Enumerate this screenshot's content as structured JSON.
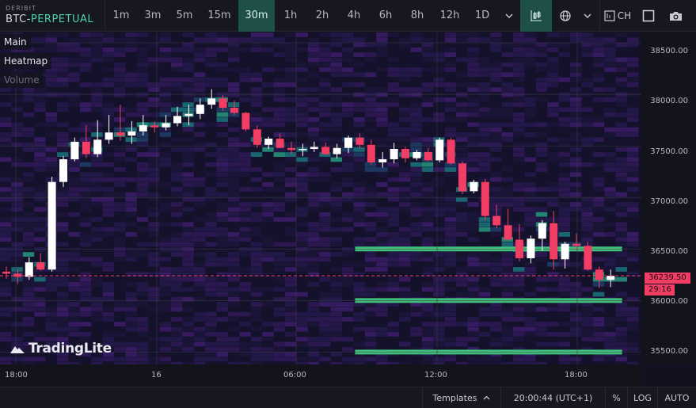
{
  "symbol": {
    "exchange": "DERIBIT",
    "pair": "BTC-",
    "pair_suffix": "PERPETUAL"
  },
  "timeframes": [
    {
      "label": "1m"
    },
    {
      "label": "3m"
    },
    {
      "label": "5m"
    },
    {
      "label": "15m"
    },
    {
      "label": "30m",
      "active": true
    },
    {
      "label": "1h"
    },
    {
      "label": "2h"
    },
    {
      "label": "4h"
    },
    {
      "label": "6h"
    },
    {
      "label": "8h"
    },
    {
      "label": "12h"
    },
    {
      "label": "1D"
    }
  ],
  "toolbar": {
    "more_timeframes_icon": "chevron-down-icon",
    "chart_type_icon": "candlestick-icon",
    "indicators_icon": "globe-icon",
    "compare_label": "CH",
    "compare_icon": "compare-icon",
    "fullscreen_icon": "fullscreen-icon",
    "screenshot_icon": "camera-icon"
  },
  "layers": {
    "main": "Main",
    "heatmap": "Heatmap",
    "volume": "Volume"
  },
  "price_axis": {
    "labels": [
      "38500.00",
      "38000.00",
      "37500.00",
      "37000.00",
      "36500.00",
      "36000.00",
      "35500.00"
    ],
    "current_price": "36239.50",
    "countdown": "29:16"
  },
  "time_axis": {
    "labels": [
      "18:00",
      "16",
      "06:00",
      "12:00",
      "18:00"
    ]
  },
  "logo": "TradingLite",
  "statusbar": {
    "templates_label": "Templates",
    "templates_icon": "chevron-up-icon",
    "clock": "20:00:44 (UTC+1)",
    "percent_label": "%",
    "log_label": "LOG",
    "auto_label": "AUTO"
  },
  "colors": {
    "up": "#ffffff",
    "down": "#f23e64",
    "accent": "#4cd3b0",
    "heat_low": "#2d1a4f",
    "heat_mid": "#1a6f7a",
    "heat_high": "#3fbf7a",
    "heat_max": "#f5e616"
  },
  "chart_data": {
    "type": "candlestick",
    "timeframe": "30m",
    "ylim": [
      35380,
      38600
    ],
    "current_price": 36239.5,
    "ohlc": [
      [
        36280,
        36330,
        36210,
        36260
      ],
      [
        36260,
        36300,
        36160,
        36230
      ],
      [
        36230,
        36420,
        36200,
        36370
      ],
      [
        36370,
        36460,
        36290,
        36300
      ],
      [
        36300,
        37200,
        36280,
        37150
      ],
      [
        37150,
        37400,
        37100,
        37370
      ],
      [
        37370,
        37580,
        37350,
        37540
      ],
      [
        37540,
        37700,
        37380,
        37420
      ],
      [
        37420,
        37750,
        37390,
        37560
      ],
      [
        37560,
        37800,
        37520,
        37630
      ],
      [
        37630,
        37900,
        37550,
        37600
      ],
      [
        37600,
        37740,
        37520,
        37640
      ],
      [
        37640,
        37800,
        37600,
        37700
      ],
      [
        37700,
        37740,
        37630,
        37680
      ],
      [
        37680,
        37800,
        37650,
        37720
      ],
      [
        37720,
        37880,
        37690,
        37790
      ],
      [
        37790,
        37900,
        37700,
        37810
      ],
      [
        37810,
        37960,
        37760,
        37900
      ],
      [
        37900,
        38050,
        37860,
        37960
      ],
      [
        37960,
        37990,
        37840,
        37870
      ],
      [
        37870,
        37940,
        37800,
        37820
      ],
      [
        37820,
        37830,
        37640,
        37660
      ],
      [
        37660,
        37700,
        37480,
        37510
      ],
      [
        37510,
        37590,
        37470,
        37570
      ],
      [
        37570,
        37620,
        37480,
        37480
      ],
      [
        37480,
        37540,
        37420,
        37460
      ],
      [
        37460,
        37520,
        37400,
        37470
      ],
      [
        37470,
        37540,
        37440,
        37490
      ],
      [
        37490,
        37530,
        37410,
        37420
      ],
      [
        37420,
        37520,
        37380,
        37480
      ],
      [
        37480,
        37600,
        37430,
        37580
      ],
      [
        37580,
        37620,
        37480,
        37510
      ],
      [
        37510,
        37560,
        37320,
        37340
      ],
      [
        37340,
        37440,
        37290,
        37370
      ],
      [
        37370,
        37530,
        37330,
        37470
      ],
      [
        37470,
        37490,
        37340,
        37380
      ],
      [
        37380,
        37460,
        37360,
        37440
      ],
      [
        37440,
        37480,
        37350,
        37360
      ],
      [
        37360,
        37580,
        37340,
        37560
      ],
      [
        37560,
        37580,
        37320,
        37330
      ],
      [
        37330,
        37350,
        37030,
        37060
      ],
      [
        37060,
        37170,
        37040,
        37150
      ],
      [
        37150,
        37180,
        36780,
        36820
      ],
      [
        36820,
        36930,
        36700,
        36730
      ],
      [
        36730,
        36890,
        36620,
        36590
      ],
      [
        36590,
        36740,
        36380,
        36410
      ],
      [
        36410,
        36630,
        36360,
        36600
      ],
      [
        36600,
        36780,
        36480,
        36750
      ],
      [
        36750,
        36870,
        36300,
        36400
      ],
      [
        36400,
        36570,
        36310,
        36550
      ],
      [
        36550,
        36650,
        36490,
        36530
      ],
      [
        36530,
        36570,
        36290,
        36300
      ],
      [
        36300,
        36330,
        36120,
        36200
      ],
      [
        36200,
        36300,
        36130,
        36239.5
      ]
    ],
    "resting_orders": [
      {
        "price": 36500,
        "from_index": 31,
        "to_index": 54,
        "intensity": "high"
      },
      {
        "price": 36000,
        "from_index": 31,
        "to_index": 54,
        "intensity": "high"
      },
      {
        "price": 35500,
        "from_index": 31,
        "to_index": 54,
        "intensity": "high"
      }
    ]
  }
}
